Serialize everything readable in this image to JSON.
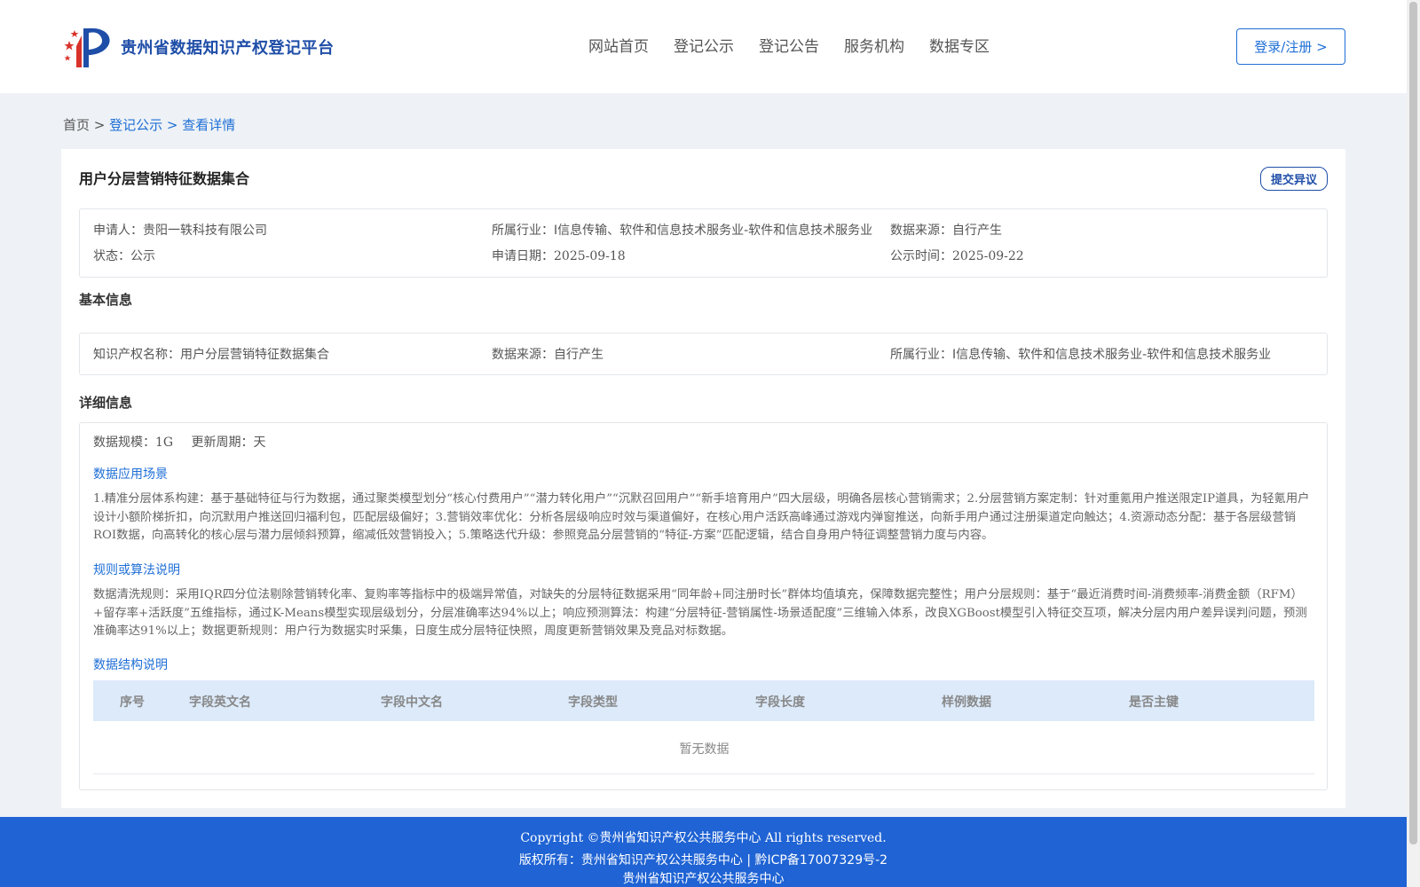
{
  "header": {
    "logo_text": "贵州省数据知识产权登记平台",
    "nav": [
      "网站首页",
      "登记公示",
      "登记公告",
      "服务机构",
      "数据专区"
    ],
    "login_label": "登录/注册 >"
  },
  "breadcrumb": {
    "home": "首页 >",
    "item1": "登记公示 >",
    "item2": "查看详情"
  },
  "page": {
    "title": "用户分层营销特征数据集合",
    "objection_label": "提交异议"
  },
  "summary": {
    "applicant_label": "申请人：",
    "applicant": "贵阳一轶科技有限公司",
    "industry_label": "所属行业：",
    "industry": "I信息传输、软件和信息技术服务业-软件和信息技术服务业",
    "source_label": "数据来源：",
    "source": "自行产生",
    "status_label": "状态：",
    "status": "公示",
    "apply_date_label": "申请日期：",
    "apply_date": "2025-09-18",
    "publish_time_label": "公示时间：",
    "publish_time": "2025-09-22"
  },
  "basic": {
    "section_title": "基本信息",
    "ip_name_label": "知识产权名称：",
    "ip_name": "用户分层营销特征数据集合",
    "source_label": "数据来源：",
    "source": "自行产生",
    "industry_label": "所属行业：",
    "industry": "I信息传输、软件和信息技术服务业-软件和信息技术服务业"
  },
  "detail": {
    "section_title": "详细信息",
    "scale_label": "数据规模：",
    "scale": "1G",
    "cycle_label": "更新周期：",
    "cycle": "天",
    "scenario_title": "数据应用场景",
    "scenario_text": "1.精准分层体系构建：基于基础特征与行为数据，通过聚类模型划分“核心付费用户”“潜力转化用户”“沉默召回用户”“新手培育用户”四大层级，明确各层核心营销需求；2.分层营销方案定制：针对重氪用户推送限定IP道具，为轻氪用户设计小额阶梯折扣，向沉默用户推送回归福利包，匹配层级偏好；3.营销效率优化：分析各层级响应时效与渠道偏好，在核心用户活跃高峰通过游戏内弹窗推送，向新手用户通过注册渠道定向触达；4.资源动态分配：基于各层级营销ROI数据，向高转化的核心层与潜力层倾斜预算，缩减低效营销投入；5.策略迭代升级：参照竞品分层营销的“特征-方案”匹配逻辑，结合自身用户特征调整营销力度与内容。",
    "rules_title": "规则或算法说明",
    "rules_text": "数据清洗规则：采用IQR四分位法剔除营销转化率、复购率等指标中的极端异常值，对缺失的分层特征数据采用“同年龄+同注册时长”群体均值填充，保障数据完整性；用户分层规则：基于“最近消费时间-消费频率-消费金额（RFM）+留存率+活跃度”五维指标，通过K-Means模型实现层级划分，分层准确率达94%以上；响应预测算法：构建“分层特征-营销属性-场景适配度”三维输入体系，改良XGBoost模型引入特征交互项，解决分层内用户差异误判问题，预测准确率达91%以上；数据更新规则：用户行为数据实时采集，日度生成分层特征快照，周度更新营销效果及竞品对标数据。",
    "structure_title": "数据结构说明",
    "table_headers": [
      "序号",
      "字段英文名",
      "字段中文名",
      "字段类型",
      "字段长度",
      "样例数据",
      "是否主键"
    ],
    "empty_text": "暂无数据"
  },
  "footer": {
    "line1": "Copyright ©贵州省知识产权公共服务中心 All rights reserved.",
    "line2": "版权所有：贵州省知识产权公共服务中心 | 黔ICP备17007329号-2",
    "line3": "贵州省知识产权公共服务中心"
  },
  "colors": {
    "brand": "#1f4ea8",
    "link": "#1f6fd6",
    "footer_bg": "#1f63d4",
    "table_head_bg": "#dceafa"
  }
}
